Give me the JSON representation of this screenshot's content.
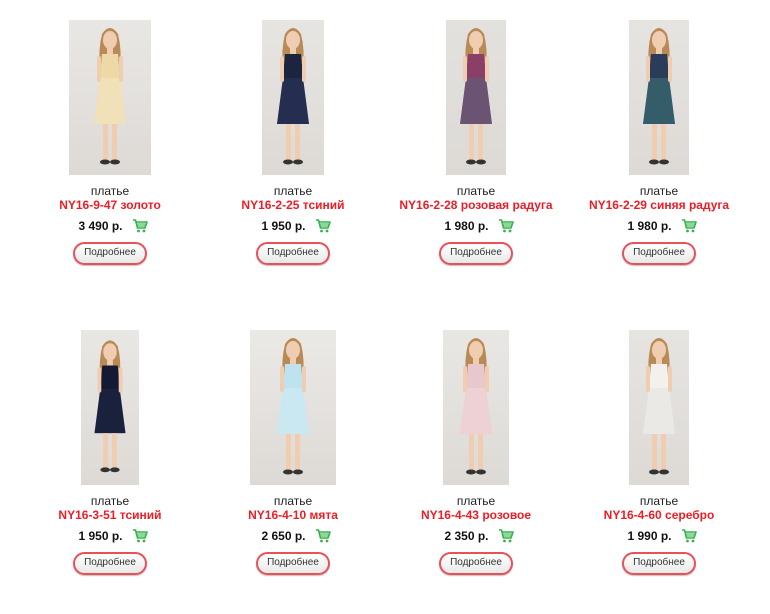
{
  "products": [
    {
      "kind": "платье",
      "sku": "NY16-9-47 золото",
      "price": "3 490 р.",
      "button": "Подробнее",
      "dress_color": "#ecd9a3",
      "dress_color2": "#f6ead0",
      "bg": "#e9e7e4"
    },
    {
      "kind": "платье",
      "sku": "NY16-2-25 тсиний",
      "price": "1 950 р.",
      "button": "Подробнее",
      "dress_color": "#1c2440",
      "dress_color2": "#2d3760",
      "bg": "#e7e5e2"
    },
    {
      "kind": "платье",
      "sku": "NY16-2-28 розовая радуга",
      "price": "1 980 р.",
      "button": "Подробнее",
      "dress_color": "#8a3f66",
      "dress_color2": "#4b6a80",
      "bg": "#e3e1de"
    },
    {
      "kind": "платье",
      "sku": "NY16-2-29 синяя радуга",
      "price": "1 980 р.",
      "button": "Подробнее",
      "dress_color": "#2a3c59",
      "dress_color2": "#3f7d79",
      "bg": "#e6e4e1"
    },
    {
      "kind": "платье",
      "sku": "NY16-3-51 тсиний",
      "price": "1 950 р.",
      "button": "Подробнее",
      "dress_color": "#141a33",
      "dress_color2": "#1f2747",
      "bg": "#e9e7e4"
    },
    {
      "kind": "платье",
      "sku": "NY16-4-10 мята",
      "price": "2 650 р.",
      "button": "Подробнее",
      "dress_color": "#bfe3ee",
      "dress_color2": "#d6eef4",
      "bg": "#ebe9e6"
    },
    {
      "kind": "платье",
      "sku": "NY16-4-43 розовое",
      "price": "2 350 р.",
      "button": "Подробнее",
      "dress_color": "#e8c8cc",
      "dress_color2": "#f1d9dc",
      "bg": "#e9e7e4"
    },
    {
      "kind": "платье",
      "sku": "NY16-4-60 серебро",
      "price": "1 990 р.",
      "button": "Подробнее",
      "dress_color": "#f2f1ee",
      "dress_color2": "#e4e2de",
      "bg": "#e6e4e1"
    }
  ],
  "colors": {
    "sku": "#ee1c25",
    "button_border": "#e8505a",
    "cart": "#33b34a"
  },
  "icons": {
    "cart": "shopping-cart-icon"
  }
}
